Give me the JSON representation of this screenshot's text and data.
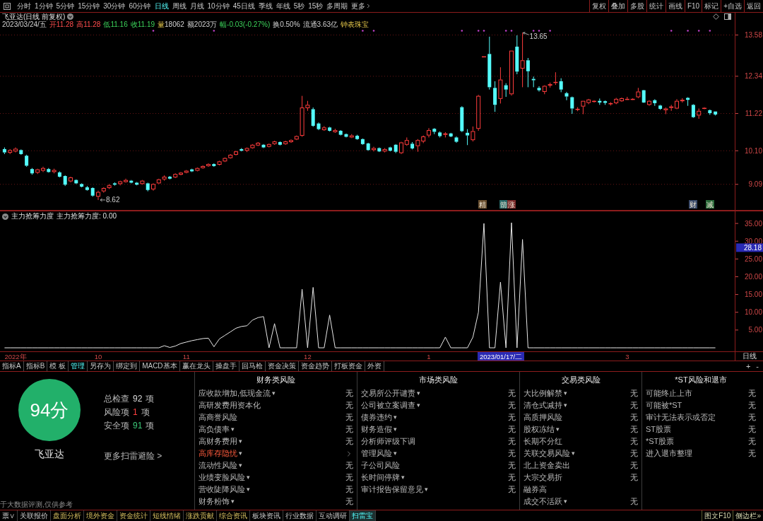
{
  "toolbar": {
    "periods": [
      {
        "label": "分时",
        "selected": false
      },
      {
        "label": "1分钟",
        "selected": false
      },
      {
        "label": "5分钟",
        "selected": false
      },
      {
        "label": "15分钟",
        "selected": false
      },
      {
        "label": "30分钟",
        "selected": false
      },
      {
        "label": "60分钟",
        "selected": false
      },
      {
        "label": "日线",
        "selected": true
      },
      {
        "label": "周线",
        "selected": false
      },
      {
        "label": "月线",
        "selected": false
      },
      {
        "label": "10分钟",
        "selected": false
      },
      {
        "label": "45日线",
        "selected": false
      },
      {
        "label": "季线",
        "selected": false
      },
      {
        "label": "年线",
        "selected": false
      },
      {
        "label": "5秒",
        "selected": false
      },
      {
        "label": "15秒",
        "selected": false
      },
      {
        "label": "多周期",
        "selected": false
      }
    ],
    "more": "更多",
    "buttons": [
      "复权",
      "叠加",
      "多股",
      "统计",
      "画线",
      "F10",
      "标记",
      "+自选",
      "返回"
    ]
  },
  "quote": {
    "title": "飞亚达(日线 前复权)",
    "date": "2023/03/24/五",
    "fields": [
      {
        "label": "开",
        "value": "11.28",
        "kind": "rise"
      },
      {
        "label": "高",
        "value": "11.28",
        "kind": "rise"
      },
      {
        "label": "低",
        "value": "11.16",
        "kind": "fall"
      },
      {
        "label": "收",
        "value": "11.19",
        "kind": "fall"
      },
      {
        "label": "量",
        "value": "18062",
        "kind": "volume"
      },
      {
        "label": "额",
        "value": "2023万",
        "kind": "plain"
      },
      {
        "label": "幅",
        "value": "-0.03(-0.27%)",
        "kind": "fall"
      },
      {
        "label": "换",
        "value": "0.50%",
        "kind": "plain"
      },
      {
        "label": "流通",
        "value": "3.63亿",
        "kind": "plain"
      }
    ],
    "industry": "钟表珠宝"
  },
  "chart": {
    "signals": [
      {
        "label": "精",
        "color": "#6a5030"
      },
      {
        "label": "箭",
        "color": "#2a6a68"
      },
      {
        "label": "涨",
        "color": "#7a2a2a"
      },
      {
        "label": "财",
        "color": "#3a4a6a"
      },
      {
        "label": "减",
        "color": "#2a6a3a"
      }
    ],
    "indicator_readout": "主力抢筹力度: 0.00",
    "chart_data": [
      {
        "type": "candlestick",
        "ohlc": [
          [
            10.15,
            10.2,
            10.0,
            10.05
          ],
          [
            10.04,
            10.15,
            10.0,
            10.12
          ],
          [
            10.08,
            10.2,
            10.05,
            10.16
          ],
          [
            10.12,
            10.14,
            9.98,
            10.0
          ],
          [
            9.95,
            9.98,
            9.62,
            9.65
          ],
          [
            9.55,
            9.58,
            9.38,
            9.42
          ],
          [
            9.44,
            9.56,
            9.4,
            9.54
          ],
          [
            9.5,
            9.62,
            9.46,
            9.58
          ],
          [
            9.55,
            9.58,
            9.44,
            9.46
          ],
          [
            9.46,
            9.56,
            9.42,
            9.52
          ],
          [
            9.45,
            9.48,
            9.3,
            9.32
          ],
          [
            9.34,
            9.36,
            9.04,
            9.08
          ],
          [
            9.18,
            9.32,
            9.15,
            9.3
          ],
          [
            9.22,
            9.24,
            9.1,
            9.12
          ],
          [
            9.1,
            9.12,
            9.0,
            9.02
          ],
          [
            9.0,
            9.04,
            8.9,
            8.92
          ],
          [
            8.98,
            9.0,
            8.72,
            8.75
          ],
          [
            8.72,
            8.9,
            8.62,
            8.86
          ],
          [
            8.88,
            9.0,
            8.84,
            8.98
          ],
          [
            8.98,
            9.1,
            8.95,
            9.06
          ],
          [
            9.12,
            9.15,
            9.05,
            9.08
          ],
          [
            9.1,
            9.2,
            9.06,
            9.18
          ],
          [
            9.16,
            9.26,
            9.14,
            9.22
          ],
          [
            9.2,
            9.22,
            9.12,
            9.14
          ],
          [
            9.14,
            9.16,
            9.06,
            9.08
          ],
          [
            9.1,
            9.22,
            9.08,
            9.2
          ],
          [
            9.12,
            9.14,
            8.88,
            8.92
          ],
          [
            8.94,
            9.12,
            8.9,
            9.1
          ],
          [
            9.12,
            9.26,
            9.1,
            9.24
          ],
          [
            9.24,
            9.36,
            9.2,
            9.32
          ],
          [
            9.32,
            9.34,
            9.24,
            9.26
          ],
          [
            9.3,
            9.42,
            9.28,
            9.4
          ],
          [
            9.38,
            9.46,
            9.36,
            9.44
          ],
          [
            9.44,
            9.52,
            9.42,
            9.5
          ],
          [
            9.54,
            9.56,
            9.46,
            9.48
          ],
          [
            9.5,
            9.6,
            9.48,
            9.58
          ],
          [
            9.58,
            9.66,
            9.56,
            9.64
          ],
          [
            9.64,
            9.72,
            9.62,
            9.7
          ],
          [
            9.7,
            9.72,
            9.62,
            9.64
          ],
          [
            9.68,
            9.8,
            9.66,
            9.78
          ],
          [
            9.78,
            9.9,
            9.76,
            9.88
          ],
          [
            9.88,
            10.0,
            9.86,
            9.98
          ],
          [
            9.98,
            10.1,
            9.96,
            10.08
          ],
          [
            10.15,
            10.18,
            10.08,
            10.1
          ],
          [
            10.1,
            10.2,
            10.06,
            10.18
          ],
          [
            10.18,
            10.3,
            10.16,
            10.28
          ],
          [
            10.26,
            10.36,
            10.24,
            10.34
          ],
          [
            10.28,
            10.3,
            10.18,
            10.2
          ],
          [
            10.22,
            10.32,
            10.2,
            10.3
          ],
          [
            10.3,
            10.4,
            10.28,
            10.38
          ],
          [
            10.36,
            10.38,
            10.26,
            10.28
          ],
          [
            10.3,
            10.4,
            10.28,
            10.38
          ],
          [
            10.36,
            10.44,
            10.34,
            10.42
          ],
          [
            10.44,
            10.56,
            10.42,
            10.54
          ],
          [
            10.55,
            11.75,
            10.52,
            11.4
          ],
          [
            11.38,
            11.6,
            11.3,
            11.48
          ],
          [
            11.35,
            11.4,
            10.82,
            10.85
          ],
          [
            10.92,
            10.95,
            10.72,
            10.75
          ],
          [
            10.72,
            10.84,
            10.7,
            10.8
          ],
          [
            10.8,
            10.82,
            10.68,
            10.7
          ],
          [
            10.66,
            10.76,
            10.64,
            10.72
          ],
          [
            10.7,
            10.72,
            10.56,
            10.58
          ],
          [
            10.6,
            10.62,
            10.5,
            10.52
          ],
          [
            10.5,
            10.6,
            10.48,
            10.56
          ],
          [
            10.55,
            10.58,
            10.43,
            10.45
          ],
          [
            10.45,
            10.47,
            10.28,
            10.3
          ],
          [
            10.32,
            10.34,
            10.1,
            10.12
          ],
          [
            10.12,
            10.22,
            10.08,
            10.18
          ],
          [
            10.18,
            10.2,
            10.06,
            10.08
          ],
          [
            10.08,
            10.18,
            10.05,
            10.15
          ],
          [
            10.2,
            10.22,
            10.08,
            10.1
          ],
          [
            10.28,
            10.3,
            10.03,
            10.07
          ],
          [
            10.03,
            10.37,
            10.0,
            10.35
          ],
          [
            10.28,
            10.5,
            10.25,
            10.42
          ],
          [
            10.31,
            10.36,
            10.14,
            10.17
          ],
          [
            10.24,
            10.45,
            10.07,
            10.42
          ],
          [
            10.38,
            10.56,
            10.33,
            10.53
          ],
          [
            10.56,
            10.78,
            10.5,
            10.72
          ],
          [
            10.76,
            10.78,
            10.6,
            10.67
          ],
          [
            10.65,
            10.68,
            10.5,
            10.54
          ],
          [
            10.58,
            10.66,
            10.5,
            10.62
          ],
          [
            10.62,
            10.64,
            10.51,
            10.53
          ],
          [
            10.5,
            10.53,
            10.34,
            10.37
          ],
          [
            11.41,
            11.44,
            10.66,
            10.69
          ],
          [
            10.64,
            10.75,
            10.27,
            10.56
          ],
          [
            10.42,
            10.83,
            10.38,
            10.69
          ],
          [
            10.76,
            11.78,
            10.7,
            11.75
          ],
          [
            12.94,
            12.94,
            12.94,
            12.94
          ],
          [
            13.01,
            13.53,
            11.94,
            12.01
          ],
          [
            11.99,
            12.19,
            11.27,
            11.48
          ],
          [
            11.66,
            12.61,
            11.52,
            12.24
          ],
          [
            12.07,
            12.13,
            11.72,
            11.94
          ],
          [
            11.8,
            13.11,
            11.76,
            13.11
          ],
          [
            13.23,
            13.57,
            12.4,
            12.48
          ],
          [
            12.57,
            13.65,
            12.01,
            12.82
          ],
          [
            12.82,
            12.89,
            12.01,
            12.49
          ],
          [
            12.26,
            12.33,
            12.01,
            12.22
          ],
          [
            11.99,
            12.04,
            11.88,
            11.92
          ],
          [
            11.87,
            12.07,
            11.8,
            12.05
          ],
          [
            12.06,
            12.15,
            12.0,
            12.1
          ],
          [
            12.14,
            12.46,
            12.08,
            12.17
          ],
          [
            12.19,
            12.28,
            11.86,
            11.94
          ],
          [
            11.83,
            11.87,
            11.62,
            11.73
          ],
          [
            11.71,
            11.73,
            11.21,
            11.37
          ],
          [
            11.36,
            11.41,
            11.29,
            11.36
          ],
          [
            11.43,
            11.6,
            11.2,
            11.6
          ],
          [
            11.54,
            11.66,
            11.5,
            11.64
          ],
          [
            11.58,
            11.62,
            11.55,
            11.6
          ],
          [
            11.6,
            11.67,
            11.48,
            11.55
          ],
          [
            11.59,
            11.61,
            11.48,
            11.54
          ],
          [
            11.53,
            11.56,
            11.46,
            11.53
          ],
          [
            11.53,
            11.69,
            11.5,
            11.66
          ],
          [
            11.59,
            11.7,
            11.57,
            11.68
          ],
          [
            11.65,
            11.72,
            11.63,
            11.66
          ],
          [
            11.65,
            11.68,
            11.63,
            11.66
          ],
          [
            11.71,
            11.99,
            11.68,
            11.88
          ],
          [
            11.92,
            11.93,
            11.54,
            11.55
          ],
          [
            11.48,
            11.62,
            11.45,
            11.6
          ],
          [
            11.62,
            11.65,
            11.45,
            11.53
          ],
          [
            11.46,
            11.48,
            11.33,
            11.36
          ],
          [
            11.32,
            11.4,
            11.2,
            11.37
          ],
          [
            11.39,
            11.48,
            11.3,
            11.43
          ],
          [
            11.37,
            11.65,
            11.35,
            11.6
          ],
          [
            11.59,
            11.68,
            11.55,
            11.63
          ],
          [
            11.69,
            11.71,
            11.45,
            11.63
          ],
          [
            11.48,
            11.5,
            11.09,
            11.11
          ],
          [
            11.16,
            11.37,
            11.06,
            11.3
          ],
          [
            11.37,
            11.41,
            11.35,
            11.39
          ],
          [
            11.32,
            11.34,
            11.18,
            11.23
          ],
          [
            11.28,
            11.28,
            11.16,
            11.19
          ]
        ],
        "ylim": [
          8.32,
          14.25
        ],
        "yticks": [
          {
            "value": 9.09,
            "label": "9.09"
          },
          {
            "value": 10.1,
            "label": "10.10"
          },
          {
            "value": 11.22,
            "label": "11.22"
          },
          {
            "value": 12.34,
            "label": "12.34"
          },
          {
            "value": 13.58,
            "label": "13.58"
          }
        ],
        "grid": true,
        "annotations": [
          "8.62",
          "13.65"
        ]
      },
      {
        "type": "line",
        "title": "主力抢筹力度",
        "categories": [
          null,
          null,
          "2022年",
          null,
          null,
          null,
          null,
          null,
          null,
          null,
          null,
          null,
          null,
          null,
          null,
          null,
          null,
          "10",
          null,
          null,
          null,
          null,
          null,
          null,
          null,
          null,
          null,
          null,
          null,
          null,
          null,
          null,
          null,
          "11",
          null,
          null,
          null,
          null,
          null,
          null,
          null,
          null,
          null,
          null,
          null,
          null,
          null,
          null,
          null,
          null,
          null,
          null,
          null,
          null,
          null,
          "12",
          null,
          null,
          null,
          null,
          null,
          null,
          null,
          null,
          null,
          null,
          null,
          null,
          null,
          null,
          null,
          null,
          null,
          null,
          null,
          null,
          null,
          "1",
          null,
          null,
          null,
          null,
          null,
          null,
          null,
          null,
          null,
          null,
          null,
          null,
          null,
          null,
          null,
          null,
          null,
          null,
          null,
          null,
          null,
          null,
          null,
          null,
          null,
          null,
          null,
          null,
          null,
          null,
          null,
          null,
          null,
          null,
          null,
          "3",
          null,
          null,
          null,
          null,
          null,
          null,
          null,
          null,
          null,
          null,
          null,
          null,
          null,
          null,
          null,
          null
        ],
        "series": [
          {
            "color": "#e8e8e8",
            "values": [
              0,
              0,
              0,
              0,
              0,
              0,
              0,
              0,
              0,
              0,
              0,
              0,
              0,
              0,
              0,
              0,
              0,
              0,
              0,
              0,
              0,
              0,
              0,
              0,
              0,
              0,
              0,
              0,
              0,
              0.6,
              0.1,
              0.5,
              1.2,
              1.6,
              2.0,
              2.3,
              2.6,
              2.7,
              0.3,
              2.5,
              3.5,
              4.5,
              5.5,
              6.0,
              6.2,
              7.8,
              8.5,
              8.8,
              0,
              6.8,
              0,
              0,
              0,
              0,
              16.5,
              0,
              17.0,
              0,
              0,
              9.2,
              0,
              0,
              0,
              0,
              0,
              0,
              0,
              0,
              0,
              0,
              0,
              0,
              0,
              0,
              0,
              0,
              0,
              0,
              0,
              0,
              3.0,
              0,
              0,
              0,
              0,
              3.0,
              10.0,
              35.0,
              0,
              0,
              18.5,
              0,
              35.2,
              0,
              30.5,
              0,
              0,
              0,
              0,
              0,
              0,
              0,
              0,
              0,
              0,
              0,
              0,
              0,
              0,
              0,
              0,
              0,
              0,
              0,
              0,
              0,
              0,
              0,
              0,
              0,
              0,
              0,
              0,
              0,
              0,
              0,
              0,
              0,
              0,
              0
            ]
          }
        ],
        "ylim": [
          -1.0,
          38.4
        ],
        "yticks": [
          {
            "value": 5,
            "label": "5.00"
          },
          {
            "value": 10,
            "label": "10.00"
          },
          {
            "value": 15,
            "label": "15.00"
          },
          {
            "value": 20,
            "label": "20.00"
          },
          {
            "value": 25,
            "label": "25.00"
          },
          {
            "value": 30,
            "label": "30.00"
          },
          {
            "value": 35,
            "label": "35.00"
          }
        ],
        "annotations": [
          "28.18"
        ]
      }
    ],
    "x_axis": {
      "cursor_date": "2023/01/17/二",
      "period": "日线"
    }
  },
  "indicator_tabs": {
    "tabs": [
      {
        "label": "指标A",
        "selected": false
      },
      {
        "label": "指标B",
        "selected": false
      },
      {
        "label": "模 板",
        "selected": false
      },
      {
        "label": "管理",
        "selected": true
      },
      {
        "label": "另存为",
        "selected": false
      },
      {
        "label": "绑定到",
        "selected": false
      },
      {
        "label": "MACD基本",
        "selected": false
      },
      {
        "label": "赢在龙头",
        "selected": false
      },
      {
        "label": "操盘手",
        "selected": false
      },
      {
        "label": "回马枪",
        "selected": false
      },
      {
        "label": "资金决策",
        "selected": false
      },
      {
        "label": "资金趋势",
        "selected": false
      },
      {
        "label": "打板资金",
        "selected": false
      },
      {
        "label": "外资",
        "selected": false
      }
    ],
    "zoom_buttons": [
      "+",
      "-"
    ]
  },
  "risk_panel": {
    "score": "94分",
    "name": "飞亚达",
    "stats": [
      {
        "label": "总检查",
        "value": "92",
        "unit": "项",
        "kind": "total"
      },
      {
        "label": "风险项",
        "value": "1",
        "unit": "项",
        "kind": "risk"
      },
      {
        "label": "安全项",
        "value": "91",
        "unit": "项",
        "kind": "safe"
      }
    ],
    "more_link": "更多扫雷避险 >",
    "footnote": "于大数据评测,仅供参考",
    "columns": [
      {
        "title": "财务类风险",
        "items": [
          {
            "label": "应收款增加,低现金流",
            "arrow": "▾",
            "value": "无",
            "alert": false
          },
          {
            "label": "高研发费用资本化",
            "value": "无",
            "alert": false
          },
          {
            "label": "高商誉风险",
            "value": "无",
            "alert": false
          },
          {
            "label": "高负债率",
            "arrow": "▾",
            "value": "无",
            "alert": false
          },
          {
            "label": "高财务费用",
            "arrow": "▾",
            "value": "无",
            "alert": false
          },
          {
            "label": "高库存隐忧",
            "arrow": "▾",
            "alert": true
          },
          {
            "label": "流动性风险",
            "arrow": "▾",
            "value": "无",
            "alert": false
          },
          {
            "label": "业绩变脸风险",
            "arrow": "▾",
            "value": "无",
            "alert": false
          },
          {
            "label": "营收陡降风险",
            "arrow": "▾",
            "value": "无",
            "alert": false
          },
          {
            "label": "财务粉饰",
            "arrow": "▾",
            "value": "无",
            "alert": false
          }
        ]
      },
      {
        "title": "市场类风险",
        "items": [
          {
            "label": "交易所公开谴责",
            "arrow": "▾",
            "value": "无",
            "alert": false
          },
          {
            "label": "公司被立案调查",
            "arrow": "▾",
            "value": "无",
            "alert": false
          },
          {
            "label": "债券违约",
            "arrow": "▾",
            "value": "无",
            "alert": false
          },
          {
            "label": "财务造假",
            "arrow": "▾",
            "value": "无",
            "alert": false
          },
          {
            "label": "分析师评级下调",
            "value": "无",
            "alert": false
          },
          {
            "label": "管理风险",
            "arrow": "▾",
            "value": "无",
            "alert": false
          },
          {
            "label": "子公司风险",
            "value": "无",
            "alert": false
          },
          {
            "label": "长时间停牌",
            "arrow": "▾",
            "value": "无",
            "alert": false
          },
          {
            "label": "审计报告保留意见",
            "arrow": "▾",
            "value": "无",
            "alert": false
          }
        ]
      },
      {
        "title": "交易类风险",
        "items": [
          {
            "label": "大比例解禁",
            "arrow": "▾",
            "value": "无",
            "alert": false
          },
          {
            "label": "清仓式减持",
            "arrow": "▾",
            "value": "无",
            "alert": false
          },
          {
            "label": "高质押风险",
            "value": "无",
            "alert": false
          },
          {
            "label": "股权冻结",
            "arrow": "▾",
            "value": "无",
            "alert": false
          },
          {
            "label": "长期不分红",
            "value": "无",
            "alert": false
          },
          {
            "label": "关联交易风险",
            "arrow": "▾",
            "value": "无",
            "alert": false
          },
          {
            "label": "北上资金卖出",
            "value": "无",
            "alert": false
          },
          {
            "label": "大宗交易折",
            "value": "无",
            "alert": false
          },
          {
            "label": "融券高",
            "alert": false
          },
          {
            "label": "成交不活跃",
            "arrow": "▾",
            "value": "无",
            "alert": false
          }
        ]
      },
      {
        "title": "*ST风险和退市",
        "items": [
          {
            "label": "可能终止上市",
            "value": "无",
            "alert": false
          },
          {
            "label": "可能被*ST",
            "value": "无",
            "alert": false
          },
          {
            "label": "审计无法表示或否定",
            "value": "无",
            "alert": false
          },
          {
            "label": "ST股票",
            "value": "无",
            "alert": false
          },
          {
            "label": "*ST股票",
            "value": "无",
            "alert": false
          },
          {
            "label": "进入退市整理",
            "value": "无",
            "alert": false
          }
        ]
      }
    ]
  },
  "status_bar": {
    "tabs": [
      {
        "label": "票∨",
        "kind": "plain",
        "selected": false
      },
      {
        "label": "关联报价",
        "kind": "plain",
        "selected": false
      },
      {
        "label": "盘面分析",
        "kind": "accent",
        "selected": false
      },
      {
        "label": "境外资金",
        "kind": "accent",
        "selected": false
      },
      {
        "label": "资金统计",
        "kind": "accent",
        "selected": false
      },
      {
        "label": "短线情绪",
        "kind": "accent",
        "selected": false
      },
      {
        "label": "涨跌贡献",
        "kind": "accent",
        "selected": false
      },
      {
        "label": "综合资讯",
        "kind": "accent",
        "selected": false
      },
      {
        "label": "板块资讯",
        "kind": "plain",
        "selected": false
      },
      {
        "label": "行业数据",
        "kind": "plain",
        "selected": false
      },
      {
        "label": "互动调研",
        "kind": "plain",
        "selected": false
      },
      {
        "label": "扫雷宝",
        "kind": "current",
        "selected": true
      }
    ],
    "right": [
      "图文F10",
      "侧边栏»"
    ]
  }
}
